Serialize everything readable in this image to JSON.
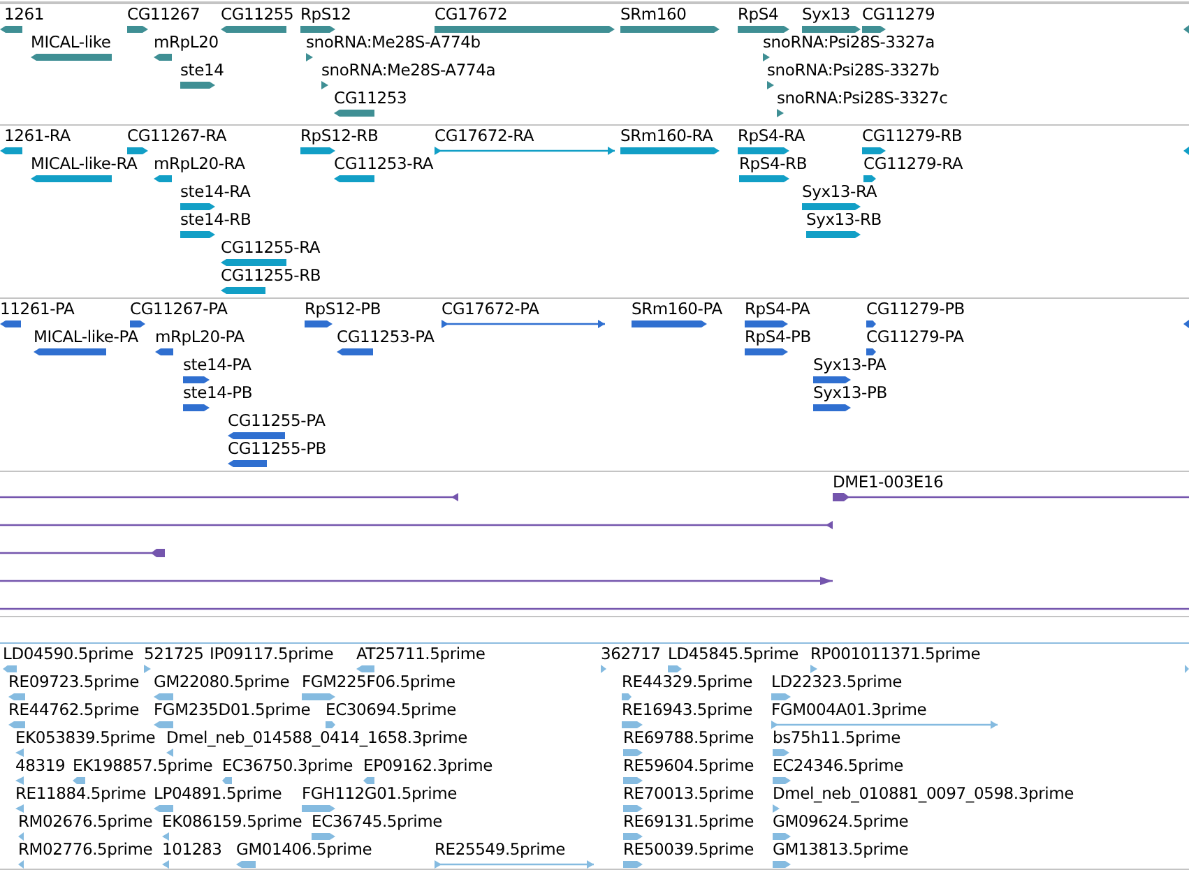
{
  "tracks": [
    {
      "kind": "gene",
      "features": [
        {
          "label": "1261",
          "reverse": true
        },
        {
          "label": "CG11267",
          "reverse": false
        },
        {
          "label": "CG11255",
          "reverse": true
        },
        {
          "label": "RpS12",
          "reverse": false
        },
        {
          "label": "CG17672",
          "reverse": false
        },
        {
          "label": "SRm160",
          "reverse": false
        },
        {
          "label": "RpS4",
          "reverse": false
        },
        {
          "label": "Syx13",
          "reverse": false
        },
        {
          "label": "CG11279",
          "reverse": false
        },
        {
          "reverse": true
        },
        {
          "label": "MICAL-like",
          "reverse": true
        },
        {
          "label": "mRpL20",
          "reverse": true
        },
        {
          "label": "snoRNA:Me28S-A774b",
          "reverse": false
        },
        {
          "label": "snoRNA:Psi28S-3327a",
          "reverse": false
        },
        {
          "label": "ste14",
          "reverse": false
        },
        {
          "label": "snoRNA:Me28S-A774a",
          "reverse": false
        },
        {
          "label": "snoRNA:Psi28S-3327b",
          "reverse": false
        },
        {
          "label": "CG11253",
          "reverse": true
        },
        {
          "label": "snoRNA:Psi28S-3327c",
          "reverse": false
        }
      ]
    },
    {
      "kind": "transcript",
      "features": [
        {
          "label": "1261-RA",
          "reverse": true
        },
        {
          "label": "CG11267-RA",
          "reverse": false
        },
        {
          "label": "RpS12-RB",
          "reverse": false
        },
        {
          "label": "CG17672-RA",
          "reverse": false
        },
        {
          "label": "SRm160-RA",
          "reverse": false
        },
        {
          "label": "RpS4-RA",
          "reverse": false
        },
        {
          "label": "CG11279-RB",
          "reverse": false
        },
        {
          "reverse": true
        },
        {
          "label": "MICAL-like-RA",
          "reverse": true
        },
        {
          "label": "mRpL20-RA",
          "reverse": true
        },
        {
          "label": "CG11253-RA",
          "reverse": true
        },
        {
          "label": "RpS4-RB",
          "reverse": false
        },
        {
          "label": "CG11279-RA",
          "reverse": false
        },
        {
          "label": "ste14-RA",
          "reverse": false
        },
        {
          "label": "Syx13-RA",
          "reverse": false
        },
        {
          "label": "ste14-RB",
          "reverse": false
        },
        {
          "label": "Syx13-RB",
          "reverse": false
        },
        {
          "label": "CG11255-RA",
          "reverse": true
        },
        {
          "label": "CG11255-RB",
          "reverse": true
        }
      ]
    },
    {
      "kind": "protein",
      "features": [
        {
          "label": "11261-PA",
          "reverse": true
        },
        {
          "label": "CG11267-PA",
          "reverse": false
        },
        {
          "label": "RpS12-PB",
          "reverse": false
        },
        {
          "label": "CG17672-PA",
          "reverse": false
        },
        {
          "label": "SRm160-PA",
          "reverse": false
        },
        {
          "label": "RpS4-PA",
          "reverse": false
        },
        {
          "label": "CG11279-PB",
          "reverse": false
        },
        {
          "reverse": true
        },
        {
          "label": "MICAL-like-PA",
          "reverse": true
        },
        {
          "label": "mRpL20-PA",
          "reverse": true
        },
        {
          "label": "CG11253-PA",
          "reverse": true
        },
        {
          "label": "RpS4-PB",
          "reverse": false
        },
        {
          "label": "CG11279-PA",
          "reverse": false
        },
        {
          "label": "ste14-PA",
          "reverse": false
        },
        {
          "label": "Syx13-PA",
          "reverse": false
        },
        {
          "label": "ste14-PB",
          "reverse": false
        },
        {
          "label": "Syx13-PB",
          "reverse": false
        },
        {
          "label": "CG11255-PA",
          "reverse": true
        },
        {
          "label": "CG11255-PB",
          "reverse": true
        }
      ]
    },
    {
      "kind": "clone",
      "features": [
        {
          "kind": "ending",
          "reverse": true
        },
        {
          "kind": "ending",
          "label": "DME1-003E16",
          "reverse": false
        },
        {
          "kind": "ending",
          "reverse": true
        },
        {
          "kind": "ending",
          "reverse": true
        },
        {
          "kind": "ending",
          "reverse": false
        },
        {
          "kind": "continuing"
        }
      ]
    },
    {
      "kind": "est",
      "features": [
        {
          "label": "LD04590.5prime",
          "reverse": true
        },
        {
          "label": "521725",
          "reverse": false
        },
        {
          "label": "IP09117.5prime"
        },
        {
          "label": "AT25711.5prime",
          "reverse": true
        },
        {
          "label": "362717",
          "reverse": false
        },
        {
          "label": "LD45845.5prime",
          "reverse": false
        },
        {
          "label": "RP001011371.5prime",
          "reverse": false
        },
        {
          "reverse": false
        },
        {
          "label": "RE09723.5prime",
          "reverse": true
        },
        {
          "label": "GM22080.5prime",
          "reverse": true
        },
        {
          "label": "FGM225F06.5prime",
          "reverse": false
        },
        {
          "label": "RE44329.5prime",
          "reverse": false
        },
        {
          "label": "LD22323.5prime",
          "reverse": false
        },
        {
          "label": "RE44762.5prime",
          "reverse": true
        },
        {
          "label": "FGM235D01.5prime",
          "reverse": true
        },
        {
          "label": "EC30694.5prime",
          "reverse": false
        },
        {
          "label": "RE16943.5prime",
          "reverse": false
        },
        {
          "label": "FGM004A01.3prime",
          "reverse": false
        },
        {
          "label": "EK053839.5prime",
          "reverse": true
        },
        {
          "label": "Dmel_neb_014588_0414_1658.3prime",
          "reverse": true
        },
        {
          "label": "RE69788.5prime",
          "reverse": false
        },
        {
          "label": "bs75h11.5prime",
          "reverse": false
        },
        {
          "label": "48319",
          "reverse": true
        },
        {
          "label": "EK198857.5prime",
          "reverse": true
        },
        {
          "label": "EC36750.3prime",
          "reverse": true
        },
        {
          "label": "EP09162.3prime",
          "reverse": true
        },
        {
          "label": "RE59604.5prime",
          "reverse": false
        },
        {
          "label": "EC24346.5prime",
          "reverse": false
        },
        {
          "label": "RE11884.5prime",
          "reverse": true
        },
        {
          "label": "LP04891.5prime",
          "reverse": true
        },
        {
          "label": "FGH112G01.5prime",
          "reverse": false
        },
        {
          "label": "RE70013.5prime",
          "reverse": false
        },
        {
          "label": "Dmel_neb_010881_0097_0598.3prime",
          "reverse": false
        },
        {
          "label": "RM02676.5prime",
          "reverse": true
        },
        {
          "label": "EK086159.5prime",
          "reverse": true
        },
        {
          "label": "EC36745.5prime",
          "reverse": false
        },
        {
          "label": "RE69131.5prime",
          "reverse": false
        },
        {
          "label": "GM09624.5prime",
          "reverse": false
        },
        {
          "label": "RM02776.5prime",
          "reverse": true
        },
        {
          "label": "101283",
          "reverse": true
        },
        {
          "label": "GM01406.5prime",
          "reverse": true
        },
        {
          "label": "RE25549.5prime",
          "reverse": false
        },
        {
          "label": "RE50039.5prime",
          "reverse": false
        },
        {
          "label": "GM13813.5prime",
          "reverse": false
        }
      ]
    }
  ]
}
